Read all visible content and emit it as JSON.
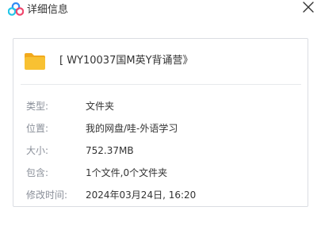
{
  "window": {
    "title": "详细信息",
    "logo_icon": "baidu-netdisk-logo",
    "close_icon": "close-icon"
  },
  "item": {
    "icon": "folder-icon",
    "name": "[ WY10037国M英Y背诵营》"
  },
  "details": [
    {
      "label": "类型:",
      "value": "文件夹"
    },
    {
      "label": "位置:",
      "value": "我的网盘/哇-外语学习"
    },
    {
      "label": "大小:",
      "value": "752.37MB"
    },
    {
      "label": "包含:",
      "value": "1个文件,0个文件夹"
    },
    {
      "label": "修改时间:",
      "value": "2024年03月24日, 16:20"
    }
  ],
  "colors": {
    "folder": "#f8c132",
    "folder_tab": "#f2a91c",
    "logo_blue": "#2f8bf5",
    "logo_cyan": "#22c6e8",
    "logo_pink": "#f0466c"
  }
}
